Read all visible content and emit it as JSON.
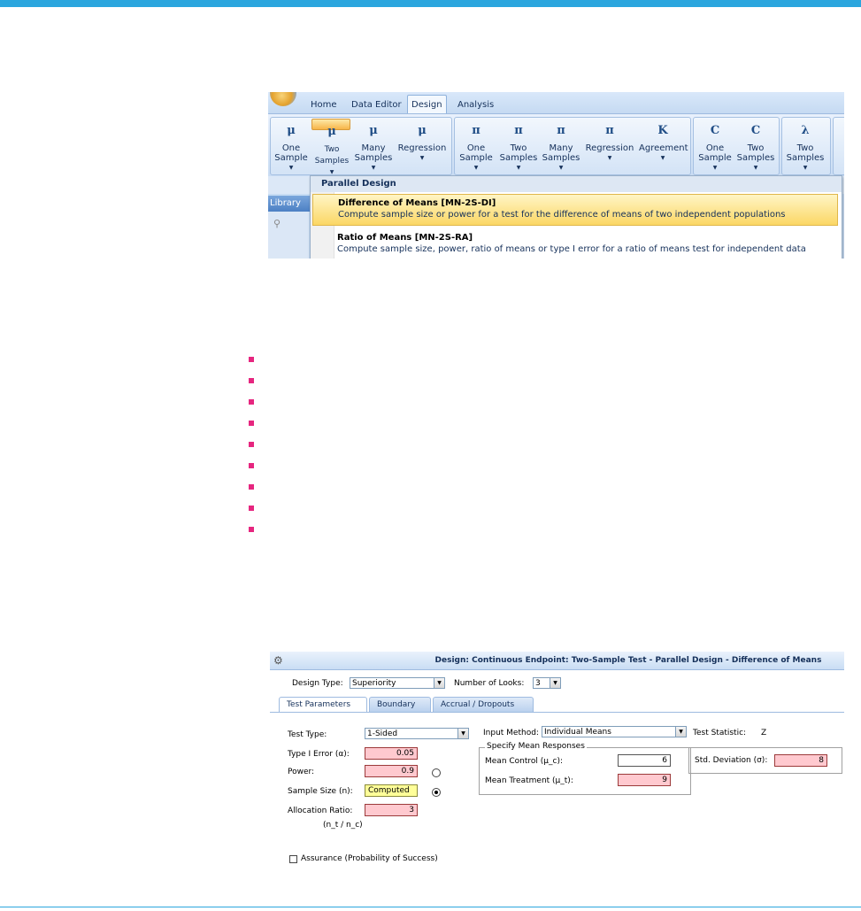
{
  "ribbon": {
    "tabs": [
      "Home",
      "Data Editor",
      "Design",
      "Analysis"
    ],
    "active_tab": "Design",
    "groups": [
      {
        "buttons": [
          {
            "icon": "μ",
            "line1": "One",
            "line2": "Sample"
          },
          {
            "icon": "μ",
            "line1": "Two",
            "line2": "Samples",
            "selected": true
          },
          {
            "icon": "μ",
            "line1": "Many",
            "line2": "Samples"
          },
          {
            "icon": "μ",
            "line1": "Regression",
            "line2": ""
          }
        ]
      },
      {
        "buttons": [
          {
            "icon": "π",
            "line1": "One",
            "line2": "Sample"
          },
          {
            "icon": "π",
            "line1": "Two",
            "line2": "Samples"
          },
          {
            "icon": "π",
            "line1": "Many",
            "line2": "Samples"
          },
          {
            "icon": "π",
            "line1": "Regression",
            "line2": ""
          },
          {
            "icon": "K",
            "line1": "Agreement",
            "line2": ""
          }
        ]
      },
      {
        "buttons": [
          {
            "icon": "C",
            "line1": "One",
            "line2": "Sample"
          },
          {
            "icon": "C",
            "line1": "Two",
            "line2": "Samples"
          }
        ]
      },
      {
        "buttons": [
          {
            "icon": "λ",
            "line1": "Two",
            "line2": "Samples"
          }
        ]
      }
    ],
    "library_label": "Library"
  },
  "dropdown": {
    "header": "Parallel Design",
    "items": [
      {
        "title": "Difference of Means [MN-2S-DI]",
        "desc": "Compute sample size or power for a test for the difference of means of two independent populations"
      },
      {
        "title": "Ratio of Means [MN-2S-RA]",
        "desc": "Compute sample size, power, ratio of means or type I error for a ratio of means test for independent data"
      }
    ]
  },
  "bullets_count": 9,
  "dialog": {
    "title": "Design: Continuous Endpoint: Two-Sample Test - Parallel Design - Difference of Means",
    "design_type_label": "Design Type:",
    "design_type_value": "Superiority",
    "num_looks_label": "Number of Looks:",
    "num_looks_value": "3",
    "tabs": [
      "Test Parameters",
      "Boundary",
      "Accrual / Dropouts"
    ],
    "test_type_label": "Test Type:",
    "test_type_value": "1-Sided",
    "type1_label": "Type I Error (α):",
    "type1_value": "0.05",
    "power_label": "Power:",
    "power_value": "0.9",
    "sample_size_label": "Sample Size (n):",
    "sample_size_value": "Computed",
    "alloc_label": "Allocation Ratio:",
    "alloc_value": "3",
    "alloc_sub": "(n_t / n_c)",
    "input_method_label": "Input Method:",
    "input_method_value": "Individual Means",
    "test_stat_label": "Test Statistic:",
    "test_stat_value": "Z",
    "mean_group_title": "Specify Mean Responses",
    "mean_control_label": "Mean Control (μ_c):",
    "mean_control_value": "6",
    "mean_treatment_label": "Mean Treatment (μ_t):",
    "mean_treatment_value": "9",
    "std_label": "Std. Deviation (σ):",
    "std_value": "8",
    "assurance_label": "Assurance (Probability of Success)"
  }
}
